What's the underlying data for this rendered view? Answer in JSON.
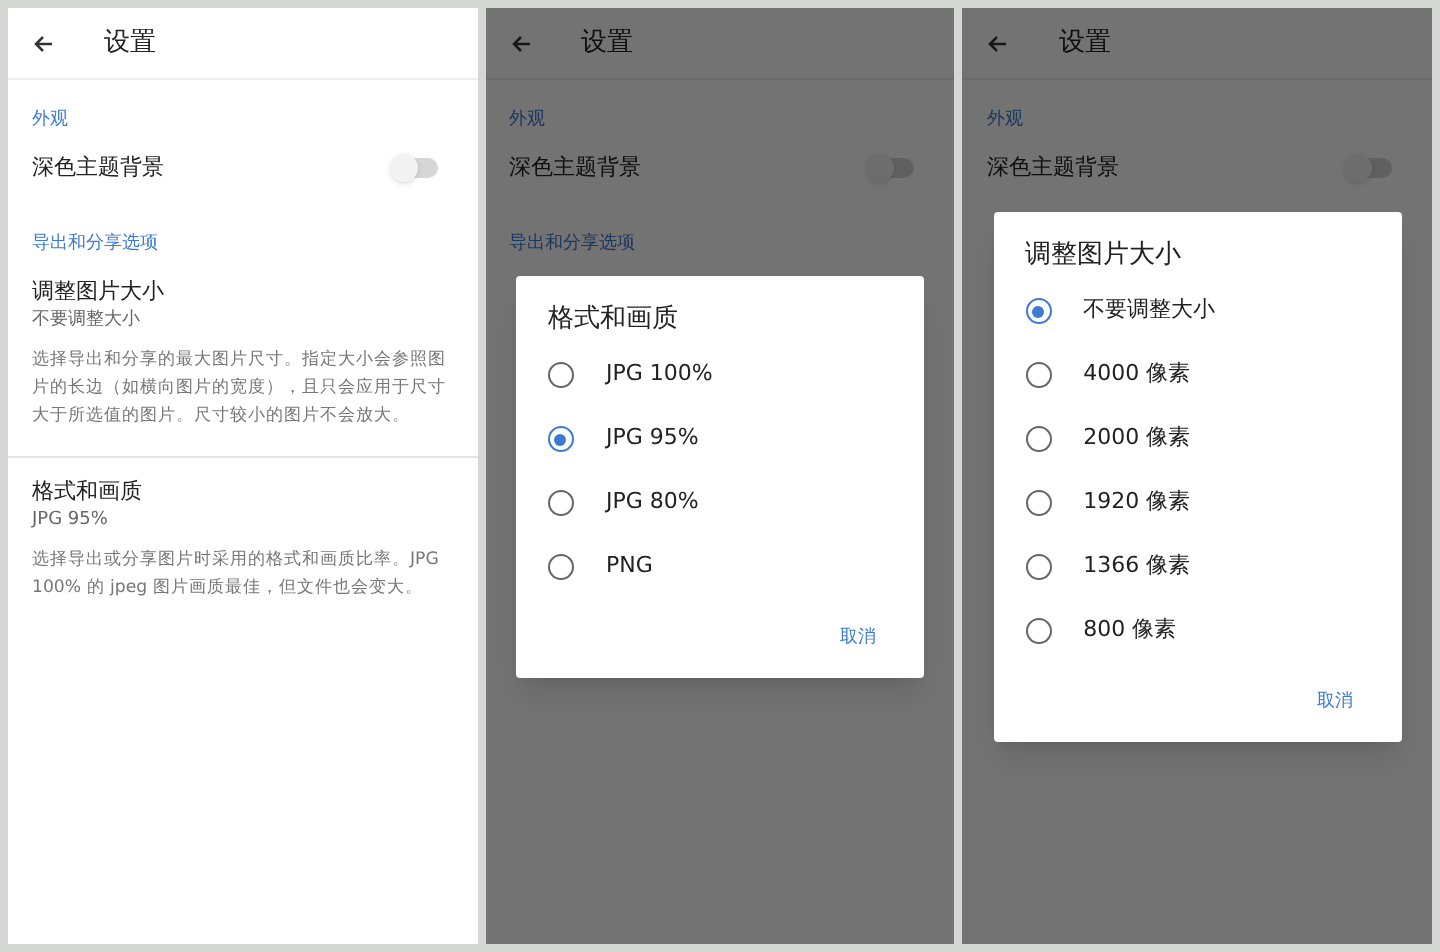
{
  "screens": [
    {
      "header": {
        "title": "设置"
      },
      "items": [
        {
          "kind": "section",
          "label": "外观"
        },
        {
          "kind": "switch",
          "label": "深色主题背景",
          "on": false
        },
        {
          "kind": "section",
          "label": "导出和分享选项"
        },
        {
          "kind": "pref",
          "title": "调整图片大小",
          "summary": "不要调整大小",
          "description": "选择导出和分享的最大图片尺寸。指定大小会参照图片的长边（如横向图片的宽度），且只会应用于尺寸大于所选值的图片。尺寸较小的图片不会放大。"
        },
        {
          "kind": "divider"
        },
        {
          "kind": "pref",
          "title": "格式和画质",
          "summary": "JPG 95%",
          "description": "选择导出或分享图片时采用的格式和画质比率。JPG 100% 的 jpeg 图片画质最佳，但文件也会变大。"
        }
      ]
    },
    {
      "header": {
        "title": "设置"
      },
      "items": [
        {
          "kind": "section",
          "label": "外观"
        },
        {
          "kind": "switch",
          "label": "深色主题背景",
          "on": false
        },
        {
          "kind": "section",
          "label": "导出和分享选项"
        }
      ],
      "dialog": {
        "title": "格式和画质",
        "options": [
          {
            "label": "JPG 100%",
            "selected": false
          },
          {
            "label": "JPG 95%",
            "selected": true
          },
          {
            "label": "JPG 80%",
            "selected": false
          },
          {
            "label": "PNG",
            "selected": false
          }
        ],
        "cancel": "取消"
      }
    },
    {
      "header": {
        "title": "设置"
      },
      "items": [
        {
          "kind": "section",
          "label": "外观"
        },
        {
          "kind": "switch",
          "label": "深色主题背景",
          "on": false
        }
      ],
      "dialog": {
        "title": "调整图片大小",
        "options": [
          {
            "label": "不要调整大小",
            "selected": true
          },
          {
            "label": "4000 像素",
            "selected": false
          },
          {
            "label": "2000 像素",
            "selected": false
          },
          {
            "label": "1920 像素",
            "selected": false
          },
          {
            "label": "1366 像素",
            "selected": false
          },
          {
            "label": "800 像素",
            "selected": false
          }
        ],
        "cancel": "取消"
      }
    }
  ]
}
